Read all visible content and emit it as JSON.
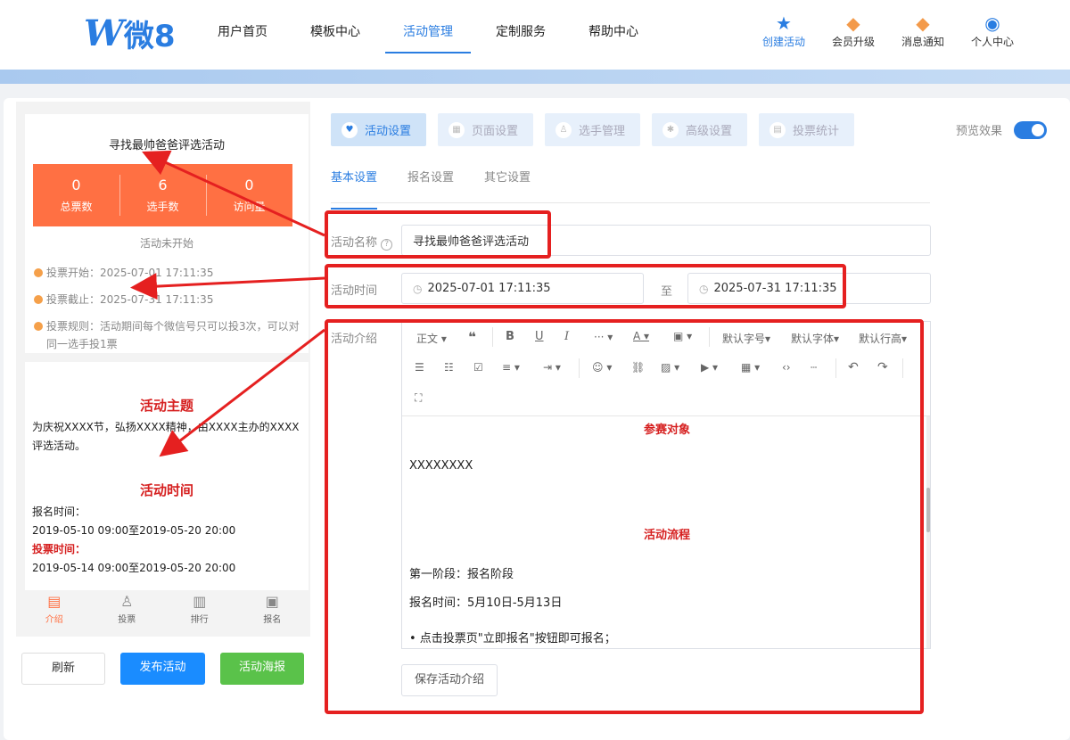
{
  "header": {
    "logo_w": "W",
    "logo_cn": "微8",
    "nav": [
      {
        "label": "用户首页",
        "active": false
      },
      {
        "label": "模板中心",
        "active": false
      },
      {
        "label": "活动管理",
        "active": true
      },
      {
        "label": "定制服务",
        "active": false
      },
      {
        "label": "帮助中心",
        "active": false
      }
    ],
    "tools": [
      {
        "label": "创建活动",
        "icon": "stars-icon"
      },
      {
        "label": "会员升级",
        "icon": "crown-icon"
      },
      {
        "label": "消息通知",
        "icon": "bell-icon"
      },
      {
        "label": "个人中心",
        "icon": "user-circle-icon"
      }
    ]
  },
  "preview": {
    "title": "寻找最帅爸爸评选活动",
    "stats": [
      {
        "num": "0",
        "label": "总票数"
      },
      {
        "num": "6",
        "label": "选手数"
      },
      {
        "num": "0",
        "label": "访问量"
      }
    ],
    "status": "活动未开始",
    "info": [
      "投票开始：2025-07-01 17:11:35",
      "投票截止：2025-07-31 17:11:35",
      "投票规则：活动期间每个微信号只可以投3次，可以对同一选手投1票"
    ],
    "theme_title": "活动主题",
    "theme_text": "为庆祝XXXX节，弘扬XXXX精神，由XXXX主办的XXXX评选活动。",
    "time_title": "活动时间",
    "signup_label": "报名时间：",
    "signup_time": "2019-05-10 09:00至2019-05-20 20:00",
    "vote_label": "投票时间：",
    "vote_time": "2019-05-14 09:00至2019-05-20 20:00",
    "bottom_tabs": [
      "介绍",
      "投票",
      "排行",
      "报名"
    ]
  },
  "buttons": {
    "refresh": "刷新",
    "publish": "发布活动",
    "poster": "活动海报",
    "save_intro": "保存活动介绍"
  },
  "steps": [
    "活动设置",
    "页面设置",
    "选手管理",
    "高级设置",
    "投票统计"
  ],
  "preview_label": "预览效果",
  "subtabs": [
    "基本设置",
    "报名设置",
    "其它设置"
  ],
  "form": {
    "name_label": "活动名称",
    "name_value": "寻找最帅爸爸评选活动",
    "time_label": "活动时间",
    "start": "2025-07-01 17:11:35",
    "to": "至",
    "end": "2025-07-31 17:11:35",
    "intro_label": "活动介绍"
  },
  "editor": {
    "toolbar": {
      "paragraph": "正文",
      "font_size": "默认字号",
      "font_family": "默认字体",
      "line_height": "默认行高"
    },
    "h1": "参赛对象",
    "p1": "XXXXXXXX",
    "h2": "活动流程",
    "p2": "第一阶段：报名阶段",
    "p3": "报名时间：5月10日-5月13日",
    "p4": "• 点击投票页\"立即报名\"按钮即可报名；"
  },
  "colors": {
    "accent": "#2a7de1",
    "stats_bg": "#ff7043",
    "annotation": "#e52020",
    "publish": "#1a8cff",
    "poster": "#5ac24a"
  }
}
